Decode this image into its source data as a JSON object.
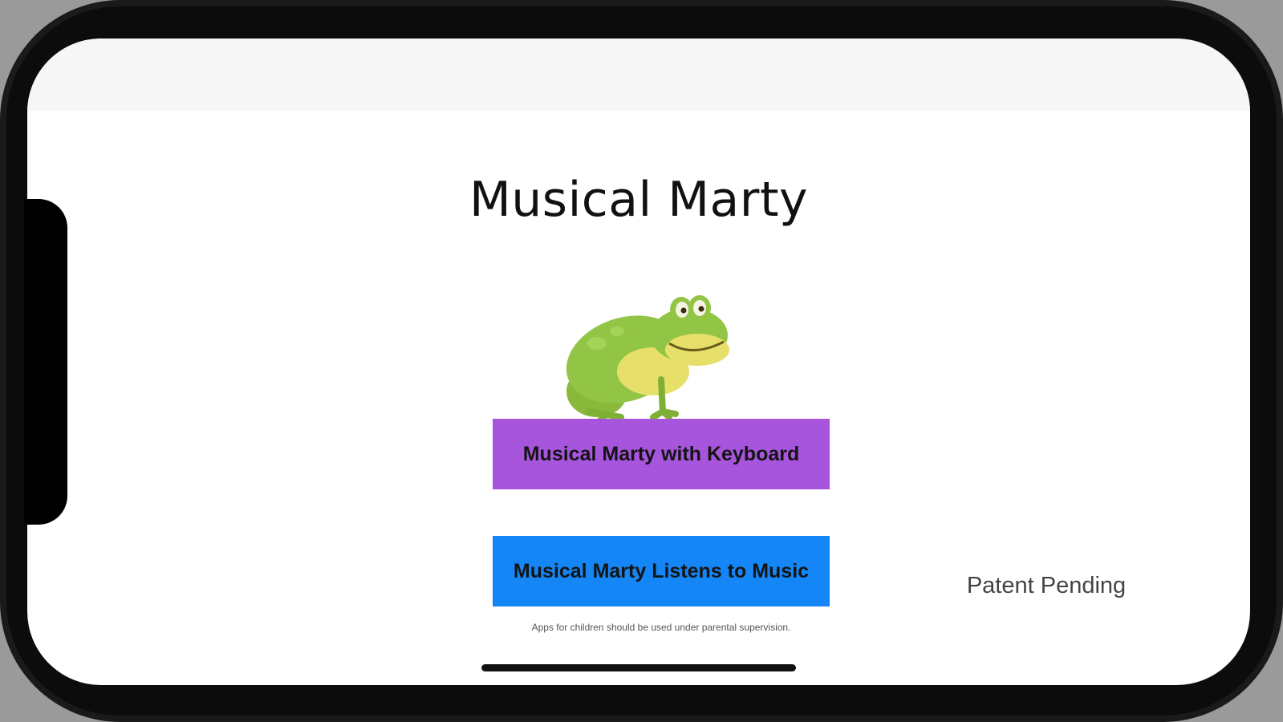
{
  "app": {
    "title": "Musical Marty"
  },
  "main": {
    "image_icon": "frog-icon",
    "buttons": [
      {
        "label": "Musical Marty with Keyboard",
        "color": "#a855de"
      },
      {
        "label": "Musical Marty Listens to Music",
        "color": "#1486f5"
      }
    ],
    "disclaimer": "Apps for children should be used under parental supervision.",
    "patent": "Patent Pending"
  }
}
